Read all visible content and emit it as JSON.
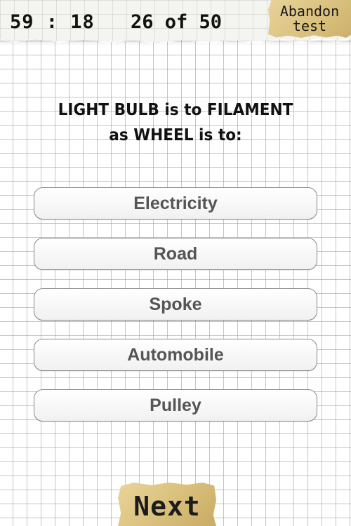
{
  "header": {
    "timer": "59 : 18",
    "progress": "26 of 50",
    "abandon_line1": "Abandon",
    "abandon_line2": "test"
  },
  "question": {
    "line1": "LIGHT BULB is to FILAMENT",
    "line2": "as WHEEL is to:"
  },
  "answers": [
    {
      "label": "Electricity"
    },
    {
      "label": "Road"
    },
    {
      "label": "Spoke"
    },
    {
      "label": "Automobile"
    },
    {
      "label": "Pulley"
    }
  ],
  "footer": {
    "next_label": "Next"
  }
}
